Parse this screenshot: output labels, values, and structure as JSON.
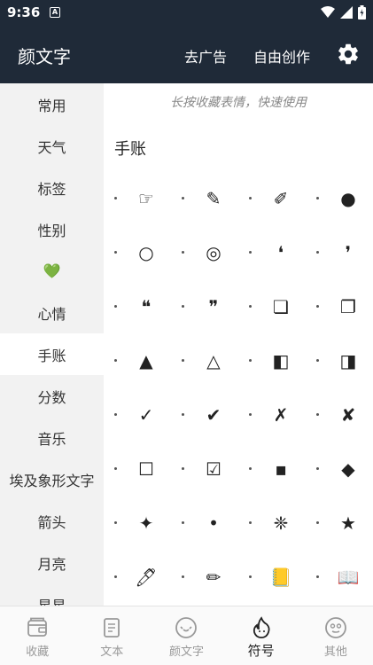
{
  "status_bar": {
    "time": "9:36",
    "notification": "A"
  },
  "app_bar": {
    "title": "颜文字",
    "remove_ads": "去广告",
    "free_create": "自由创作"
  },
  "sidebar": {
    "items": [
      {
        "label": "常用"
      },
      {
        "label": "天气"
      },
      {
        "label": "标签"
      },
      {
        "label": "性别"
      },
      {
        "label": "💚"
      },
      {
        "label": "心情"
      },
      {
        "label": "手账",
        "active": true
      },
      {
        "label": "分数"
      },
      {
        "label": "音乐"
      },
      {
        "label": "埃及象形文字"
      },
      {
        "label": "箭头"
      },
      {
        "label": "月亮"
      },
      {
        "label": "星星"
      }
    ]
  },
  "content": {
    "hint": "长按收藏表情，快速使用",
    "section_title": "手账",
    "rows": [
      [
        "☞",
        "✎",
        "✐",
        "●"
      ],
      [
        "○",
        "◎",
        "❛",
        "❜"
      ],
      [
        "❝",
        "❞",
        "❏",
        "❐"
      ],
      [
        "▲",
        "△",
        "◧",
        "◨"
      ],
      [
        "✓",
        "✔",
        "✗",
        "✘"
      ],
      [
        "☐",
        "☑",
        "▪",
        "◆"
      ],
      [
        "✦",
        "•",
        "❈",
        "★"
      ],
      [
        "🖊",
        "✏",
        "📒",
        "📖"
      ]
    ]
  },
  "bottom_nav": {
    "items": [
      {
        "label": "收藏"
      },
      {
        "label": "文本"
      },
      {
        "label": "颜文字"
      },
      {
        "label": "符号",
        "active": true
      },
      {
        "label": "其他"
      }
    ]
  },
  "colors": {
    "header_bg": "#1f2a38",
    "sidebar_bg": "#f2f2f2",
    "active_bg": "#ffffff"
  }
}
